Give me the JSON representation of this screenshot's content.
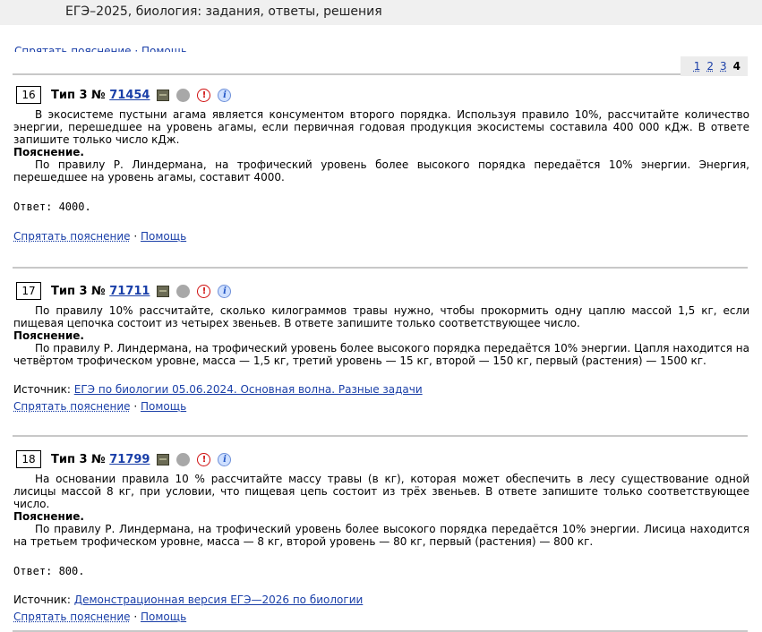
{
  "topbar": {
    "title": "ЕГЭ–2025, биология: задания, ответы, решения"
  },
  "cut_links": {
    "text": "Спрятать пояснение · Помощь"
  },
  "pagination": {
    "pages": [
      "1",
      "2",
      "3"
    ],
    "current": "4"
  },
  "type_prefix": "Тип 3 № ",
  "explanation_label": "Пояснение.",
  "hide_label": "Спрятать пояснение",
  "separator": " · ",
  "help_label": "Помощь",
  "source_label": "Источник: ",
  "tasks": [
    {
      "number": "16",
      "id": "71454",
      "question": "В экосистеме пустыни агама является консументом второго порядка. Используя правило 10%, рассчитайте количество энергии, перешедшее на уровень агамы, если первичная годовая продукция экосистемы составила 400 000 кДж. В ответе запишите только число кДж.",
      "explanation": "По правилу Р. Линдермана, на трофический уровень более высокого порядка передаётся 10% энергии. Энергия, перешедшее на уровень агамы, составит 4000.",
      "answer": "Ответ: 4000."
    },
    {
      "number": "17",
      "id": "71711",
      "question": "По правилу 10% рассчитайте, сколько килограммов травы нужно, чтобы прокормить одну цаплю массой 1,5 кг, если пищевая цепочка состоит из четырех звеньев. В ответе запишите только соответствующее число.",
      "explanation": "По правилу Р. Линдермана, на трофический уровень более высокого порядка передаётся 10% энергии. Цапля находится на четвёртом трофическом уровне, масса — 1,5 кг, третий уровень — 15 кг, второй — 150 кг, первый (растения) — 1500 кг.",
      "source": "ЕГЭ по биологии 05.06.2024. Основная волна. Разные задачи"
    },
    {
      "number": "18",
      "id": "71799",
      "question": "На основании правила 10 % рассчитайте массу травы (в кг), которая может обеспечить в лесу существование одной лисицы массой 8 кг, при условии, что пищевая цепь состоит из трёх звеньев. В ответе запишите только соответствующее число.",
      "explanation": "По правилу Р. Линдермана, на трофический уровень более высокого порядка передаётся 10% энергии. Лисица находится на третьем трофическом уровне, масса — 8 кг, второй уровень — 80 кг, первый (растения) — 800 кг.",
      "answer": "Ответ: 800.",
      "source": "Демонстрационная версия ЕГЭ—2026 по биологии"
    }
  ]
}
